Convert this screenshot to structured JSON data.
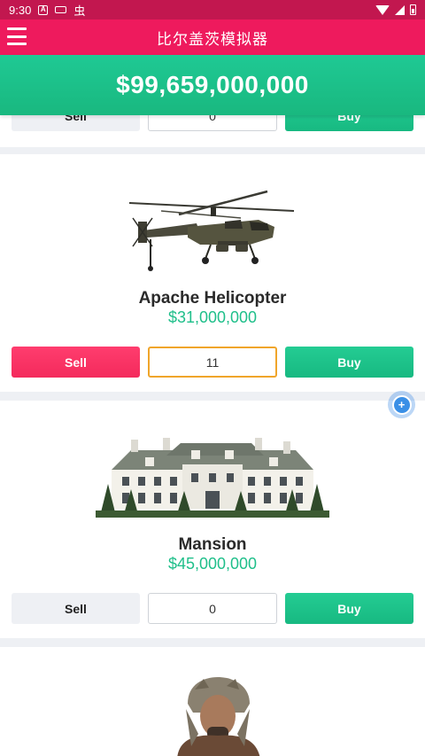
{
  "status_bar": {
    "time": "9:30",
    "icons": [
      "a-box-icon",
      "keyboard-icon",
      "bug-icon",
      "wifi-icon",
      "signal-icon",
      "battery-icon"
    ]
  },
  "app_bar": {
    "title": "比尔盖茨模拟器",
    "menu_icon": "hamburger-menu-icon"
  },
  "balance": {
    "amount": "$99,659,000,000"
  },
  "items": [
    {
      "name": "",
      "price": "",
      "sell_label": "Sell",
      "quantity": "0",
      "buy_label": "Buy"
    },
    {
      "name": "Apache Helicopter",
      "price": "$31,000,000",
      "image": "helicopter-image",
      "sell_label": "Sell",
      "quantity": "11",
      "buy_label": "Buy"
    },
    {
      "name": "Mansion",
      "price": "$45,000,000",
      "image": "mansion-image",
      "sell_label": "Sell",
      "quantity": "0",
      "buy_label": "Buy"
    },
    {
      "name": "",
      "image": "person-image"
    }
  ],
  "floating_button": {
    "icon": "plus-icon",
    "symbol": "+"
  },
  "colors": {
    "status_bar": "#c2174f",
    "app_bar": "#ee1a5d",
    "balance": "#1fc994",
    "price": "#1fbf8a",
    "sell_active": "#f42a5c",
    "buy": "#17b981",
    "quantity_focus": "#f0a52a"
  }
}
